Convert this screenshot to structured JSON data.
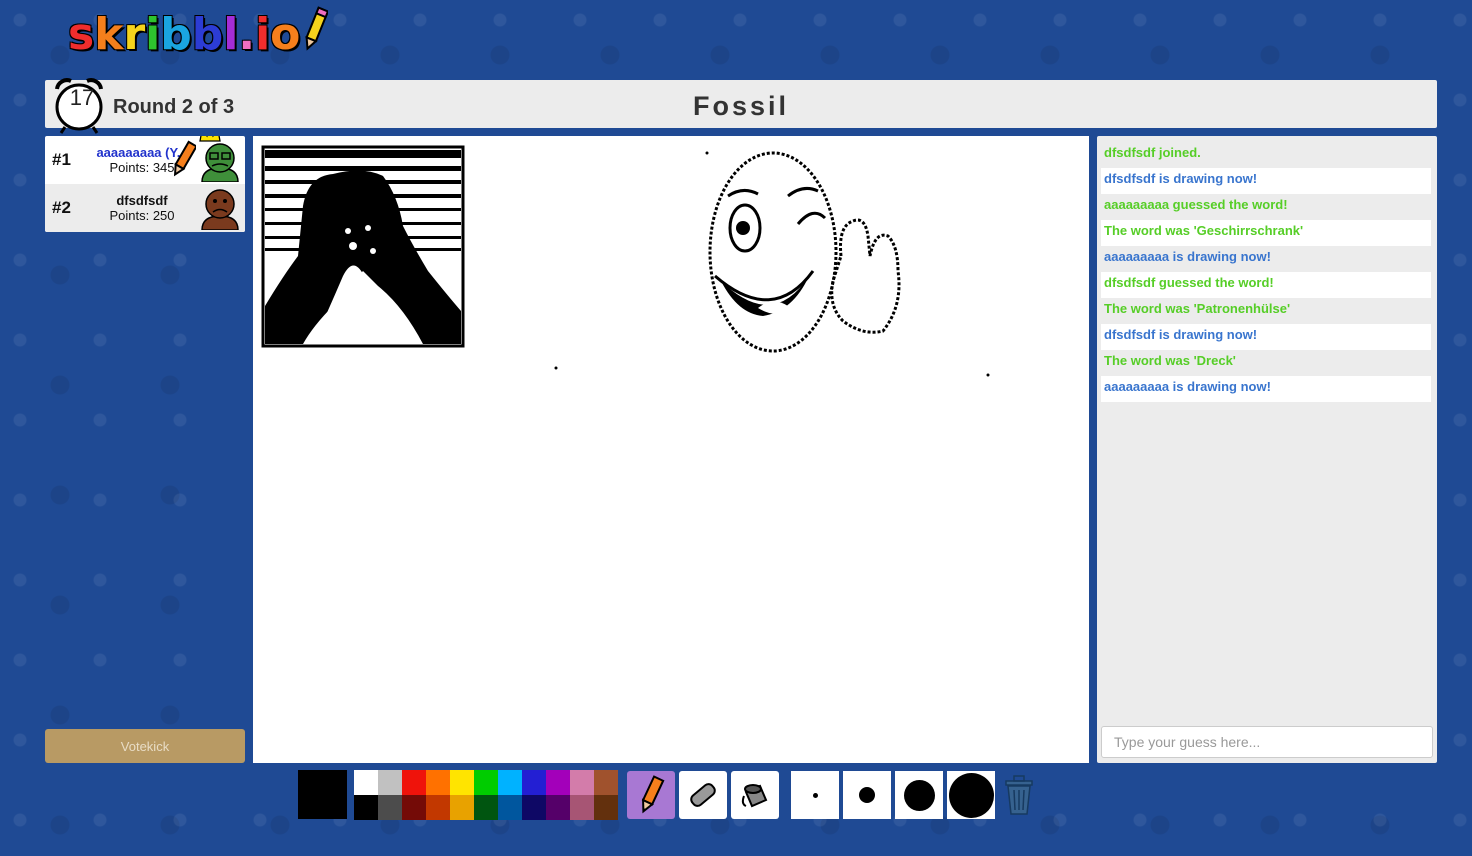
{
  "logo": {
    "letters": [
      {
        "char": "s",
        "color": "#f02d2d"
      },
      {
        "char": "k",
        "color": "#f57f1c"
      },
      {
        "char": "r",
        "color": "#f5d31c"
      },
      {
        "char": "i",
        "color": "#2ec22e"
      },
      {
        "char": "b",
        "color": "#1aa5e0"
      },
      {
        "char": "b",
        "color": "#2c3cd4"
      },
      {
        "char": "l",
        "color": "#a42dd6"
      },
      {
        "char": ".",
        "color": "#f06ec0"
      },
      {
        "char": "i",
        "color": "#f02d2d"
      },
      {
        "char": "o",
        "color": "#f57f1c"
      }
    ]
  },
  "header": {
    "timer": "17",
    "round": "Round 2 of 3",
    "word": "Fossil"
  },
  "players": [
    {
      "rank": "#1",
      "name": "aaaaaaaaa (Y...",
      "points": "Points: 345",
      "is_me": true,
      "drawing": true,
      "crown": true,
      "avatar_color": "#3f8f3a"
    },
    {
      "rank": "#2",
      "name": "dfsdfsdf",
      "points": "Points: 250",
      "is_me": false,
      "drawing": false,
      "crown": false,
      "avatar_color": "#7a3a1e"
    }
  ],
  "votekick_label": "Votekick",
  "chat": {
    "messages": [
      {
        "text": "dfsdfsdf joined.",
        "color": "green"
      },
      {
        "text": "dfsdfsdf is drawing now!",
        "color": "blue"
      },
      {
        "text": "aaaaaaaaa guessed the word!",
        "color": "green"
      },
      {
        "text": "The word was 'Geschirrschrank'",
        "color": "green"
      },
      {
        "text": "aaaaaaaaa is drawing now!",
        "color": "blue"
      },
      {
        "text": "dfsdfsdf guessed the word!",
        "color": "green"
      },
      {
        "text": "The word was 'Patronenhülse'",
        "color": "green"
      },
      {
        "text": "dfsdfsdf is drawing now!",
        "color": "blue"
      },
      {
        "text": "The word was 'Dreck'",
        "color": "green"
      },
      {
        "text": "aaaaaaaaa is drawing now!",
        "color": "blue"
      }
    ],
    "input_placeholder": "Type your guess here..."
  },
  "toolbar": {
    "current_color": "#000000",
    "palette_top": [
      "#ffffff",
      "#c1c1c1",
      "#ef130b",
      "#ff7100",
      "#ffe400",
      "#00cc00",
      "#00b2ff",
      "#231fd3",
      "#a300ba",
      "#d37caa",
      "#a0522d"
    ],
    "palette_bottom": [
      "#000000",
      "#4c4c4c",
      "#740b07",
      "#c23800",
      "#e8a200",
      "#005510",
      "#00569e",
      "#0e0865",
      "#550069",
      "#a75574",
      "#63300d"
    ],
    "tools": [
      "pencil-icon",
      "eraser-icon",
      "fill-bucket-icon"
    ],
    "selected_tool": "pencil-icon",
    "brush_sizes": [
      "small",
      "medium",
      "large",
      "xlarge"
    ]
  },
  "colors": {
    "background": "#1f4a94",
    "panel": "#ececec",
    "chat_green": "#56ce27",
    "chat_blue": "#3975ce",
    "votekick": "#b89a64"
  }
}
